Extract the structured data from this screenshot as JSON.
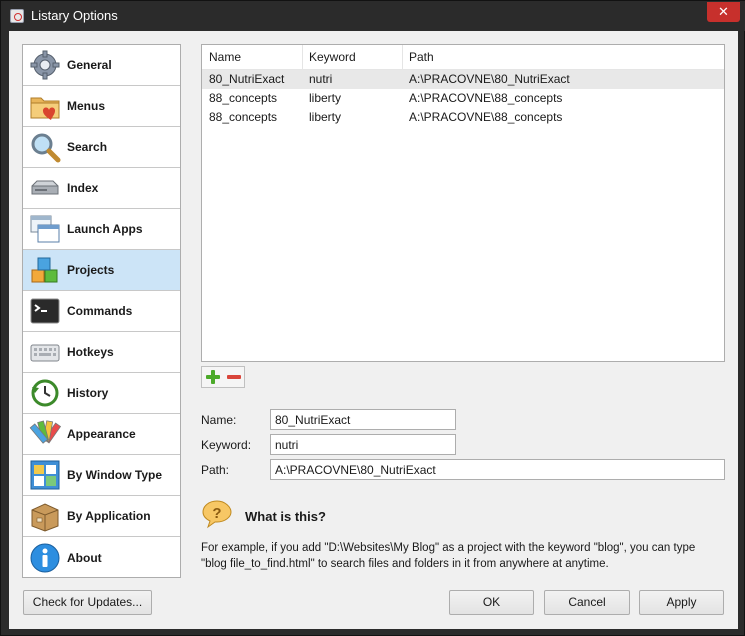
{
  "window": {
    "title": "Listary Options",
    "close_glyph": "✕"
  },
  "sidebar": {
    "items": [
      {
        "label": "General",
        "icon": "gear-icon"
      },
      {
        "label": "Menus",
        "icon": "folder-heart-icon"
      },
      {
        "label": "Search",
        "icon": "magnifier-icon"
      },
      {
        "label": "Index",
        "icon": "drive-icon"
      },
      {
        "label": "Launch Apps",
        "icon": "windows-icon"
      },
      {
        "label": "Projects",
        "icon": "blocks-icon",
        "selected": true
      },
      {
        "label": "Commands",
        "icon": "terminal-icon"
      },
      {
        "label": "Hotkeys",
        "icon": "keyboard-icon"
      },
      {
        "label": "History",
        "icon": "clock-icon"
      },
      {
        "label": "Appearance",
        "icon": "palette-icon"
      },
      {
        "label": "By Window Type",
        "icon": "window-grid-icon"
      },
      {
        "label": "By Application",
        "icon": "box-icon"
      },
      {
        "label": "About",
        "icon": "info-icon"
      }
    ]
  },
  "projects_table": {
    "columns": [
      "Name",
      "Keyword",
      "Path"
    ],
    "rows": [
      {
        "name": "80_NutriExact",
        "keyword": "nutri",
        "path": "A:\\PRACOVNE\\80_NutriExact",
        "highlighted": true
      },
      {
        "name": "88_concepts",
        "keyword": "liberty",
        "path": "A:\\PRACOVNE\\88_concepts"
      },
      {
        "name": "88_concepts",
        "keyword": "liberty",
        "path": "A:\\PRACOVNE\\88_concepts"
      }
    ]
  },
  "form": {
    "name_label": "Name:",
    "name_value": "80_NutriExact",
    "keyword_label": "Keyword:",
    "keyword_value": "nutri",
    "path_label": "Path:",
    "path_value": "A:\\PRACOVNE\\80_NutriExact"
  },
  "help": {
    "title": "What is this?",
    "text": "For example, if you add \"D:\\Websites\\My Blog\" as a project with the keyword \"blog\", you can type \"blog file_to_find.html\" to search files and folders in it from anywhere at anytime."
  },
  "buttons": {
    "check_updates": "Check for Updates...",
    "ok": "OK",
    "cancel": "Cancel",
    "apply": "Apply"
  },
  "colors": {
    "selected_bg": "#cce4f7",
    "close_red": "#c7302c",
    "add_green": "#4caa2a",
    "remove_red": "#d9453b"
  }
}
